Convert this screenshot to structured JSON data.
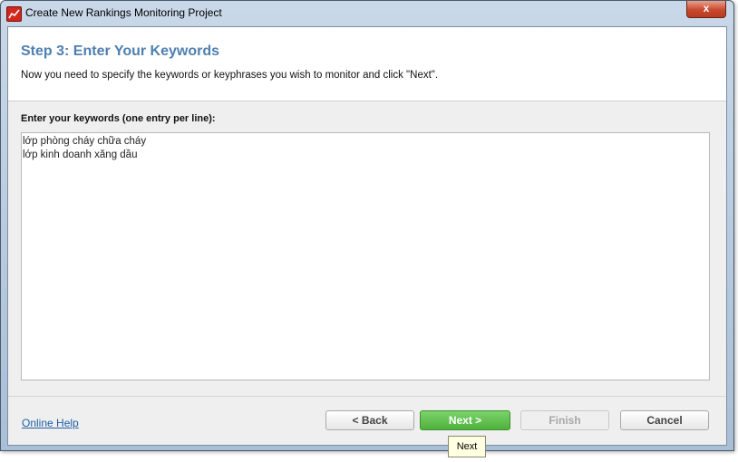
{
  "window": {
    "title": "Create New Rankings Monitoring Project",
    "close_label": "x"
  },
  "header": {
    "step_title": "Step 3: Enter Your Keywords",
    "description": "Now you need to specify the keywords or keyphrases you wish to monitor and click \"Next\"."
  },
  "keywords": {
    "label": "Enter your keywords (one entry per line):",
    "lines": [
      "lớp phòng cháy chữa cháy",
      "lớp kinh doanh xăng dầu"
    ]
  },
  "footer": {
    "help_link": "Online Help",
    "back_label": "< Back",
    "next_label": "Next >",
    "finish_label": "Finish",
    "cancel_label": "Cancel"
  },
  "tooltip": {
    "text": "Next"
  },
  "icons": {
    "app": "rankings-chart-icon",
    "close": "close-icon"
  },
  "colors": {
    "accent": "#4f7fb0",
    "next_button": "#55b542",
    "link": "#1f5fa8"
  }
}
